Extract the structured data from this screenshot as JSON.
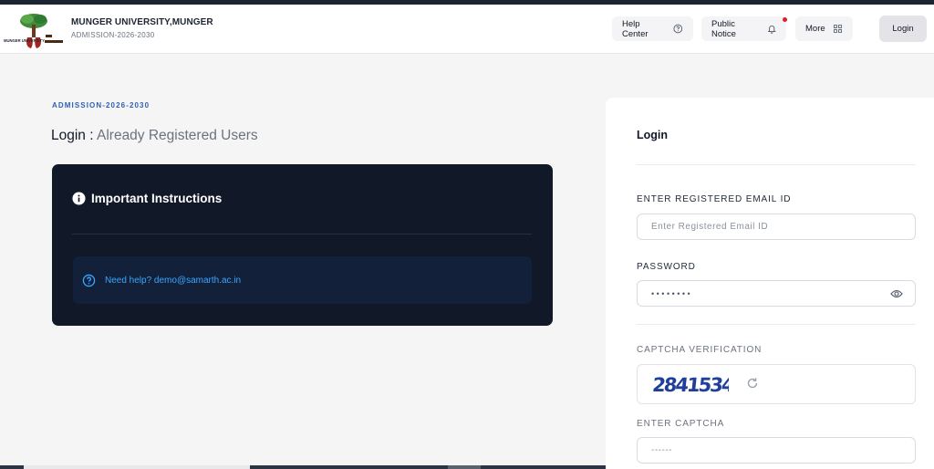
{
  "header": {
    "university_name": "MUNGER UNIVERSITY,MUNGER",
    "subtitle": "ADMISSION-2026-2030",
    "help_center": "Help Center",
    "public_notice": "Public Notice",
    "more": "More",
    "login": "Login",
    "logo_text": "MUNGER UNIVERSITY"
  },
  "main": {
    "tag": "ADMISSION-2026-2030",
    "title_prefix": "Login : ",
    "title_suffix": "Already Registered Users"
  },
  "instructions": {
    "heading": "Important Instructions",
    "help_text": "Need help? demo@samarth.ac.in"
  },
  "login_form": {
    "title": "Login",
    "email_label": "ENTER REGISTERED EMAIL ID",
    "email_placeholder": "Enter Registered Email ID",
    "password_label": "PASSWORD",
    "password_value": "••••••••",
    "captcha_label": "CAPTCHA VERIFICATION",
    "captcha_text": "2841534",
    "enter_captcha_label": "ENTER CAPTCHA",
    "enter_captcha_placeholder": "------"
  },
  "colors": {
    "accent_blue": "#2f5fb3",
    "dark_card": "#111827",
    "help_link": "#3aa6ff",
    "notification_dot": "#e11d2e"
  },
  "icons": [
    "question-circle-icon",
    "bell-icon",
    "grid-icon",
    "info-icon",
    "eye-icon",
    "refresh-icon"
  ]
}
